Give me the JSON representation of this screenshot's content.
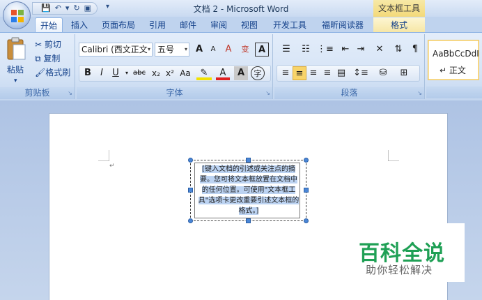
{
  "window": {
    "title": "文档 2 - Microsoft Word",
    "context_title": "文本框工具"
  },
  "tabs": [
    {
      "label": "开始",
      "active": true
    },
    {
      "label": "插入"
    },
    {
      "label": "页面布局"
    },
    {
      "label": "引用"
    },
    {
      "label": "邮件"
    },
    {
      "label": "审阅"
    },
    {
      "label": "视图"
    },
    {
      "label": "开发工具"
    },
    {
      "label": "福昕阅读器"
    },
    {
      "label": "格式",
      "contextual": true
    }
  ],
  "clipboard": {
    "paste": "粘贴",
    "cut": "剪切",
    "copy": "复制",
    "format_painter": "格式刷",
    "group_label": "剪贴板"
  },
  "font": {
    "font_name": "Calibri (西文正文",
    "font_size": "五号",
    "group_label": "字体",
    "bold": "B",
    "italic": "I",
    "underline": "U",
    "strike": "abc",
    "subscript": "x₂",
    "superscript": "x²",
    "change_case": "Aa",
    "grow": "A",
    "shrink": "A",
    "clear": "A",
    "char_border": "A",
    "enclose": "字",
    "phonetic": "变",
    "font_color": "A",
    "char_shading": "A"
  },
  "paragraph": {
    "group_label": "段落"
  },
  "styles": {
    "sample": "AaBbCcDdI",
    "name": "↵ 正文"
  },
  "document": {
    "textbox_text": "[键入文档的引述或关注点的摘要。您可将文本框放置在文档中的任何位置。可使用\"文本框工具\"选项卡更改重要引述文本框的格式。]"
  },
  "brand": {
    "main": "百科全说",
    "sub": "助你轻松解决"
  },
  "colors": {
    "accent_green": "#1fa055",
    "ribbon_blue": "#15428b",
    "context_yellow": "#f3d97a"
  }
}
